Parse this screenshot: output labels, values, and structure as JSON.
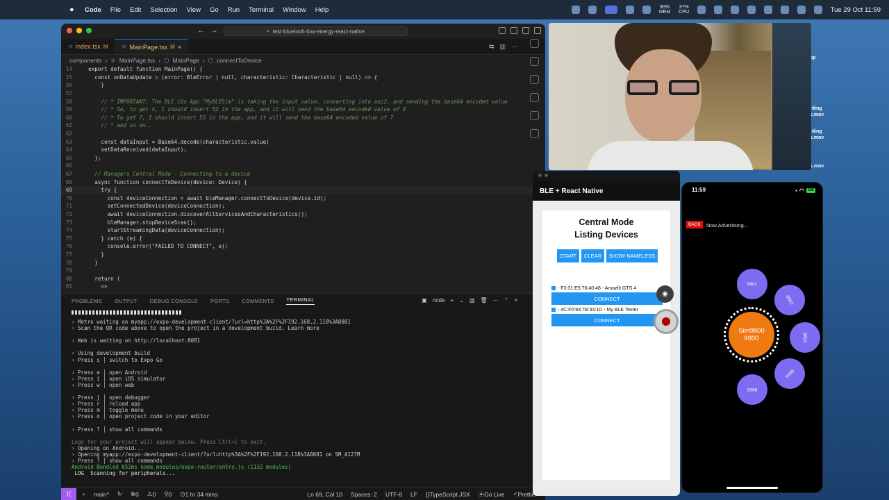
{
  "menubar": {
    "app": "Code",
    "items": [
      "File",
      "Edit",
      "Selection",
      "View",
      "Go",
      "Run",
      "Terminal",
      "Window",
      "Help"
    ],
    "mem": "90%\nMEM",
    "cpu": "37%\nCPU",
    "datetime": "Tue 29 Oct  11:59"
  },
  "vscode": {
    "search": "test-bluetooh-low-energy-react-native",
    "tabs": [
      {
        "name": "index.tsx",
        "mod": "M"
      },
      {
        "name": "MainPage.tsx",
        "mod": "M"
      }
    ],
    "breadcrumb": [
      "components",
      "MainPage.tsx",
      "MainPage",
      "connectToDevice"
    ],
    "panel_tabs": [
      "PROBLEMS",
      "OUTPUT",
      "DEBUG CONSOLE",
      "PORTS",
      "COMMENTS",
      "TERMINAL"
    ],
    "panel_right": "node",
    "status": {
      "branch": "main*",
      "errors": "0",
      "warnings": "0",
      "ports": "0",
      "time": "1 hr 34 mins",
      "position": "Ln 69, Col 10",
      "spaces": "Spaces: 2",
      "encoding": "UTF-8",
      "eol": "LF",
      "lang": "TypeScript JSX",
      "golive": "Go Live",
      "prettier": "Prettier"
    }
  },
  "code_lines": [
    {
      "n": "14",
      "t": "  export default function MainPage() {"
    },
    {
      "n": "15",
      "t": "    const onDataUpdate = (error: BleError | null, characteristic: Characteristic | null) => {"
    },
    {
      "n": "56",
      "t": "      }"
    },
    {
      "n": "57",
      "t": ""
    },
    {
      "n": "58",
      "t": "      // * IMPORTANT: The BLE iOs App \"MyBLESim\" is taking the input value, converting into asc2, and sending the base64 encoded value",
      "c": true
    },
    {
      "n": "59",
      "t": "      // * So, to get 4, I should insert 52 in the app, and it will send the base64 encoded value of 4",
      "c": true
    },
    {
      "n": "60",
      "t": "      // * To get 7, I should insert 55 in the app, and it will send the base64 encoded value of 7",
      "c": true
    },
    {
      "n": "61",
      "t": "      // * and so on...",
      "c": true
    },
    {
      "n": "62",
      "t": ""
    },
    {
      "n": "63",
      "t": "      const dataInput = Base64.decode(characteristic.value)"
    },
    {
      "n": "64",
      "t": "      setDataReceived(dataInput);"
    },
    {
      "n": "65",
      "t": "    };"
    },
    {
      "n": "66",
      "t": ""
    },
    {
      "n": "67",
      "t": "    // Managers Central Mode - Connecting to a device",
      "c": true
    },
    {
      "n": "68",
      "t": "    async function connectToDevice(device: Device) {"
    },
    {
      "n": "69",
      "t": "      try {",
      "cur": true
    },
    {
      "n": "70",
      "t": "        const deviceConnection = await bleManager.connectToDevice(device.id);"
    },
    {
      "n": "71",
      "t": "        setConnectedDevice(deviceConnection);"
    },
    {
      "n": "72",
      "t": "        await deviceConnection.discoverAllServicesAndCharacteristics();"
    },
    {
      "n": "73",
      "t": "        bleManager.stopDeviceScan();"
    },
    {
      "n": "74",
      "t": "        startStreamingData(deviceConnection);"
    },
    {
      "n": "75",
      "t": "      } catch (e) {"
    },
    {
      "n": "76",
      "t": "        console.error(\"FAILED TO CONNECT\", e);"
    },
    {
      "n": "77",
      "t": "      }"
    },
    {
      "n": "78",
      "t": "    }"
    },
    {
      "n": "79",
      "t": ""
    },
    {
      "n": "80",
      "t": "    return ("
    },
    {
      "n": "81",
      "t": "      <>"
    }
  ],
  "terminal": [
    "› Metro waiting on myapp://expo-development-client/?url=http%3A%2F%2F192.168.2.118%3A8081",
    "› Scan the QR code above to open the project in a development build. Learn more",
    "",
    "› Web is waiting on http://localhost:8081",
    "",
    "› Using development build",
    "› Press s │ switch to Expo Go",
    "",
    "› Press a │ open Android",
    "› Press i │ open iOS simulator",
    "› Press w │ open web",
    "",
    "› Press j │ open debugger",
    "› Press r │ reload app",
    "› Press m │ toggle menu",
    "› Press o │ open project code in your editor",
    "",
    "› Press ? │ show all commands",
    "",
    "Logs for your project will appear below. Press Ctrl+C to exit.",
    "› Opening on Android...",
    "› Opening myapp://expo-development-client/?url=http%3A%2F%2F192.168.2.118%3A8081 on SM_A127M",
    "› Press ? │ show all commands",
    "Android Bundled 652ms node_modules/expo-router/entry.js (1132 modules)",
    " LOG  Scanning for peripherals..."
  ],
  "android": {
    "appbar_title": "BLE + React Native",
    "heading_1": "Central Mode",
    "heading_2": "Listing Devices",
    "buttons": [
      "START",
      "CLEAR",
      "SHOW NAMELESS"
    ],
    "devices": [
      {
        "name": "- F3:31:E5:76:40:48 - Amazfit GTS 4",
        "connect": "CONNECT"
      },
      {
        "name": "- 4C:F0:93:7B:33:1D - My BLE Tester",
        "connect": "CONNECT"
      }
    ]
  },
  "iphone": {
    "time": "11:59",
    "battery": "100",
    "back": "BACK",
    "status": "Now Advertising...",
    "center_line1": "Sim9800",
    "center_line2": "9800",
    "nodes": [
      "9801",
      "9802",
      "9803",
      "9804",
      "9805"
    ]
  },
  "desktop_labels": [
    "pp",
    "rding",
    "s.mov",
    "rding",
    "s.mov",
    "s.mov"
  ]
}
